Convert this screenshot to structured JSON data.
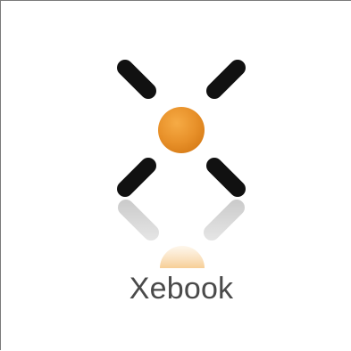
{
  "app": {
    "logo_text": "Xebook",
    "logo_icon": "x-mark-with-orange-dot-icon"
  },
  "colors": {
    "arm": "#111111",
    "dot": "#e8912a",
    "dot_highlight": "#f5b35a",
    "text": "#4a4a4a",
    "border": "#7a7a7a",
    "background": "#ffffff"
  }
}
